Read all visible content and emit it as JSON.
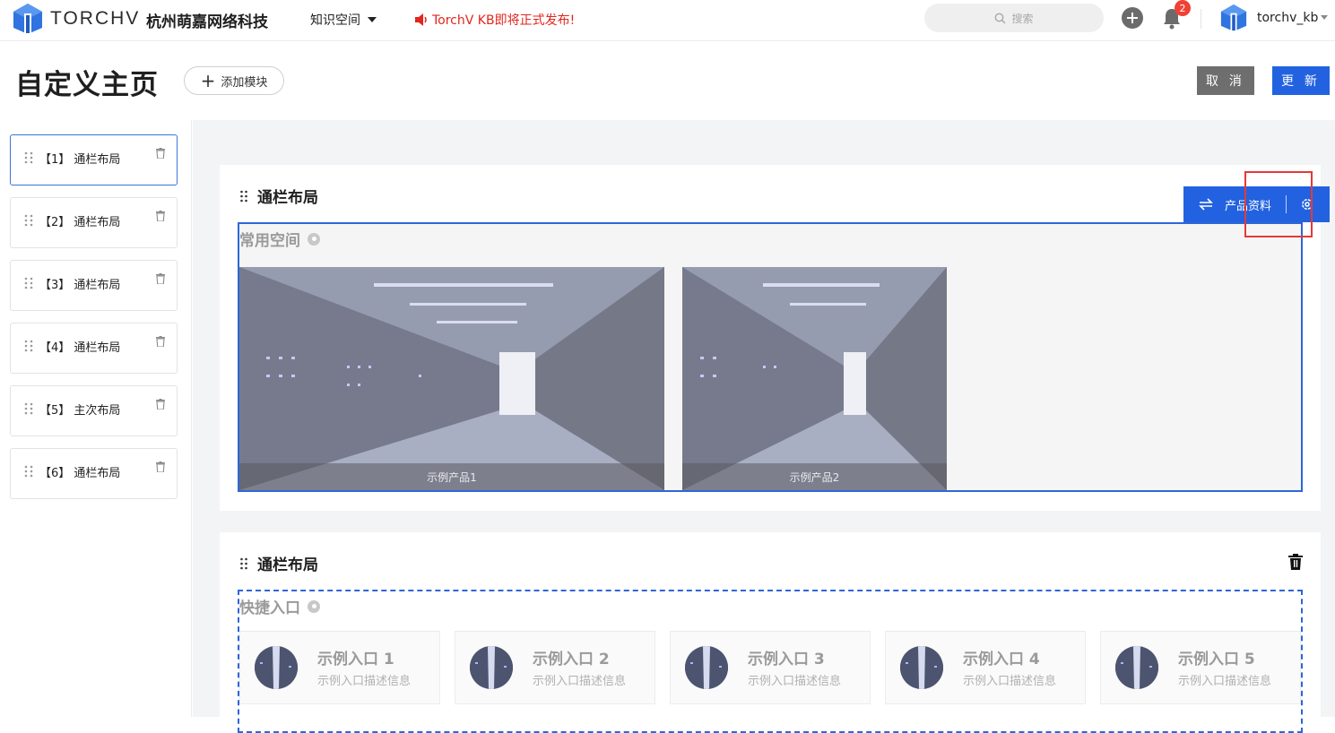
{
  "header": {
    "brand": "TORCHV",
    "company": "杭州萌嘉网络科技",
    "space_menu": "知识空间",
    "notice": "TorchV KB即将正式发布!",
    "search_placeholder": "搜索",
    "notification_count": "2",
    "username": "torchv_kb",
    "accent": "#2262e0"
  },
  "page": {
    "title": "自定义主页",
    "add_module_label": "添加模块",
    "cancel_label": "取 消",
    "update_label": "更 新"
  },
  "sidebar": {
    "items": [
      {
        "label": "【1】 通栏布局",
        "active": true
      },
      {
        "label": "【2】 通栏布局"
      },
      {
        "label": "【3】 通栏布局"
      },
      {
        "label": "【4】 通栏布局"
      },
      {
        "label": "【5】 主次布局"
      },
      {
        "label": "【6】 通栏布局"
      }
    ]
  },
  "modules": [
    {
      "title": "通栏布局",
      "section_title": "常用空间",
      "toolbar_label": "产品资料",
      "tiles": [
        "示例产品1",
        "示例产品2"
      ]
    },
    {
      "title": "通栏布局",
      "section_title": "快捷入口",
      "entries": [
        {
          "title": "示例入口 1",
          "desc": "示例入口描述信息"
        },
        {
          "title": "示例入口 2",
          "desc": "示例入口描述信息"
        },
        {
          "title": "示例入口 3",
          "desc": "示例入口描述信息"
        },
        {
          "title": "示例入口 4",
          "desc": "示例入口描述信息"
        },
        {
          "title": "示例入口 5",
          "desc": "示例入口描述信息"
        }
      ]
    }
  ]
}
